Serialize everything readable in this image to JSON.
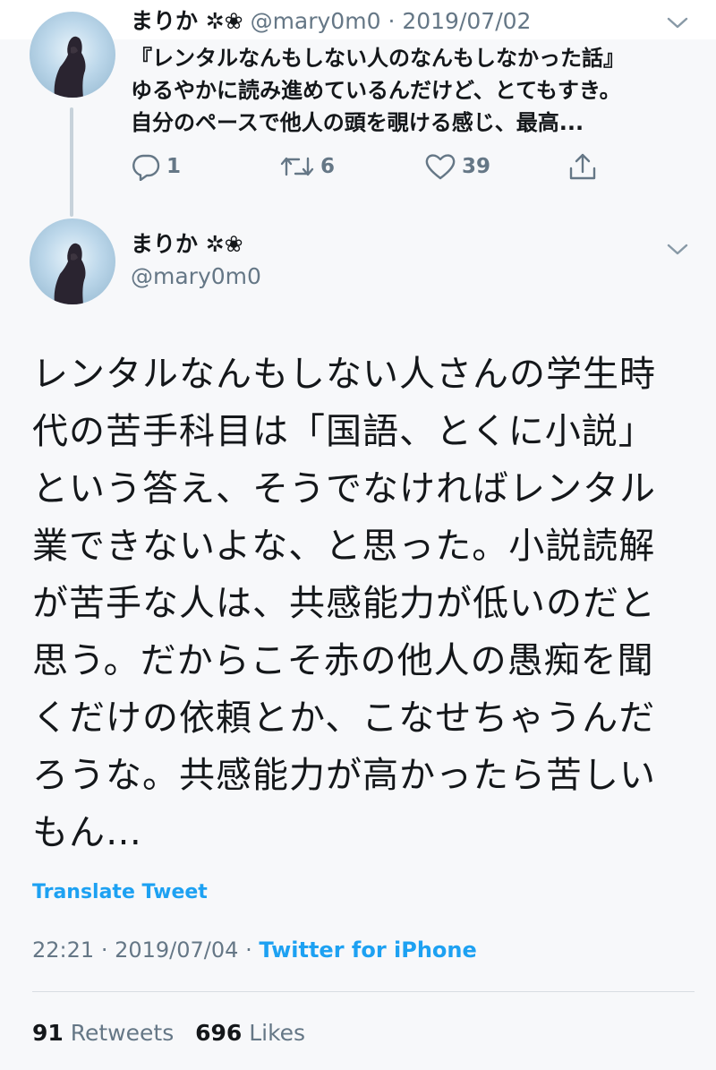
{
  "previous_tweet": {
    "display_name": "まりか ✲❀",
    "handle": "@mary0m0",
    "separator": "·",
    "date": "2019/07/02",
    "body_lines": [
      "『レンタルなんもしない人のなんもしなかった話』",
      "ゆるやかに読み進めているんだけど、とてもすき。",
      "自分のペースで他人の頭を覗ける感じ、最高..."
    ],
    "replies": "1",
    "retweets": "6",
    "likes": "39",
    "icons": [
      "reply-icon",
      "retweet-icon",
      "like-icon",
      "share-icon",
      "chevron-down-icon"
    ]
  },
  "main_tweet": {
    "display_name": "まりか ✲❀",
    "handle": "@mary0m0",
    "body_lines": [
      "レンタルなんもしない人さんの学生時",
      "代の苦手科目は「国語、とくに小説」",
      "という答え、そうでなければレンタル",
      "業できないよな、と思った。小説読解",
      "が苦手な人は、共感能力が低いのだと",
      "思う。だからこそ赤の他人の愚痴を聞",
      "くだけの依頼とか、こなせちゃうんだ",
      "ろうな。共感能力が高かったら苦しい",
      "もん…"
    ],
    "translate_label": "Translate Tweet",
    "time": "22:21",
    "separator": "·",
    "date": "2019/07/04",
    "source": "Twitter for iPhone",
    "retweet_count": "91",
    "retweet_label": "Retweets",
    "like_count": "696",
    "like_label": "Likes"
  },
  "colors": {
    "background": "#f7f8fa",
    "text": "#14171a",
    "secondary": "#657786",
    "accent": "#1da1f2",
    "thread_line": "#c7d2da"
  }
}
